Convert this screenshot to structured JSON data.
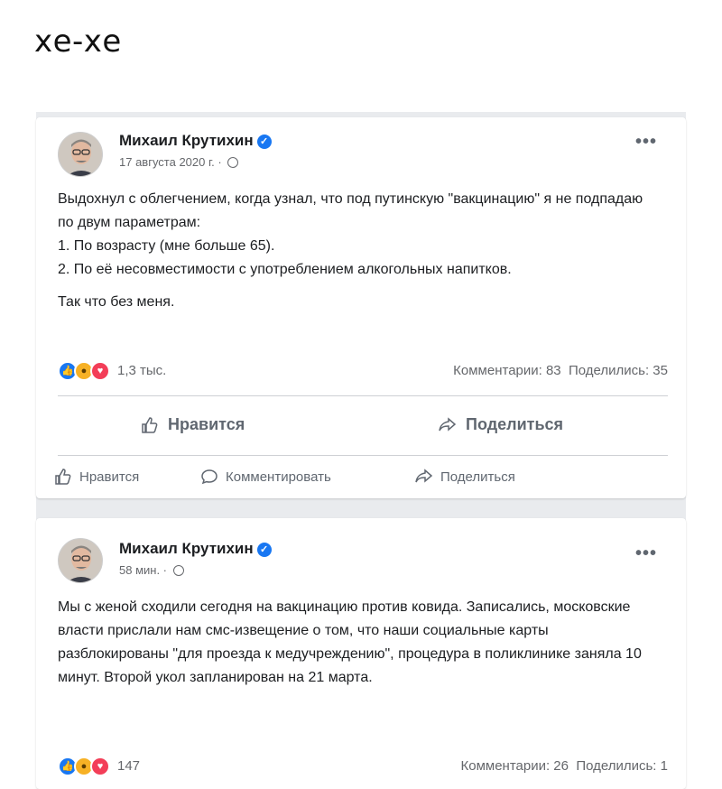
{
  "caption": "хе-хе",
  "colors": {
    "accent": "#1877f2",
    "love": "#f33e58",
    "haha": "#f7b125"
  },
  "posts": [
    {
      "author": "Михаил Крутихин",
      "verified_icon": "verified-check-icon",
      "timestamp": "17 августа 2020 г.",
      "privacy_icon": "globe-icon",
      "more_icon": "•••",
      "paragraphs": [
        "Выдохнул с облегчением, когда узнал, что под путинскую \"вакцинацию\" я не подпадаю по двум параметрам:",
        "1. По возрасту (мне больше 65).",
        "2. По её несовместимости с употреблением алкогольных напитков.",
        "Так что без меня."
      ],
      "reaction_count": "1,3 тыс.",
      "comments": "Комментарии: 83",
      "shares": "Поделились: 35",
      "big_actions": {
        "like": "Нравится",
        "share": "Поделиться"
      },
      "small_actions": {
        "like": "Нравится",
        "comment": "Комментировать",
        "share": "Поделиться"
      }
    },
    {
      "author": "Михаил Крутихин",
      "verified_icon": "verified-check-icon",
      "timestamp": "58 мин.",
      "privacy_icon": "globe-icon",
      "more_icon": "•••",
      "text": "Мы с женой сходили сегодня на вакцинацию против ковида. Записались, московские власти прислали нам смс-извещение о том, что наши социальные карты разблокированы \"для проезда к медучреждению\", процедура в поликлинике заняла 10 минут. Второй укол запланирован на 21 марта.",
      "reaction_count": "147",
      "comments": "Комментарии: 26",
      "shares": "Поделились: 1"
    }
  ]
}
